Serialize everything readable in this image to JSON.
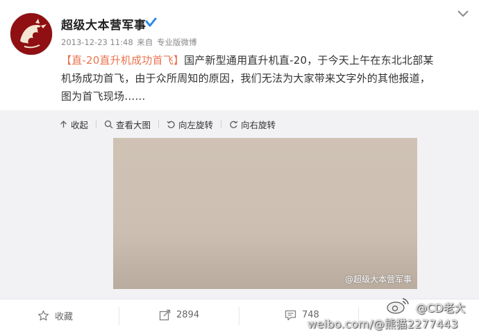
{
  "author": {
    "name": "超级大本营军事",
    "date": "2013-12-23 11:48",
    "source_prefix": "来自",
    "source": "专业版微博"
  },
  "post": {
    "topic": "【直-20直升机成功首飞】",
    "body_line1": "国产新型通用直升机直-20，于今天上午在东北北部某",
    "body_line2": "机场成功首飞，由于众所周知的原因，我们无法为大家带来文字外的其他报道，",
    "body_line3": "图为首飞现场……"
  },
  "media_toolbar": {
    "collapse": "收起",
    "view_large": "查看大图",
    "rotate_left": "向左旋转",
    "rotate_right": "向右旋转"
  },
  "photo": {
    "watermark": "@超级大本营军事"
  },
  "actions": {
    "favorite": "收藏",
    "repost_count": "2894",
    "comment_count": "748"
  },
  "page_watermark": {
    "site": "weibo.com/",
    "user": "@CD老大",
    "handle": "@熊猫2277443"
  },
  "colors": {
    "link": "#eb7350",
    "verified": "#2a8ae6",
    "avatar_bg": "#8f0f12"
  }
}
